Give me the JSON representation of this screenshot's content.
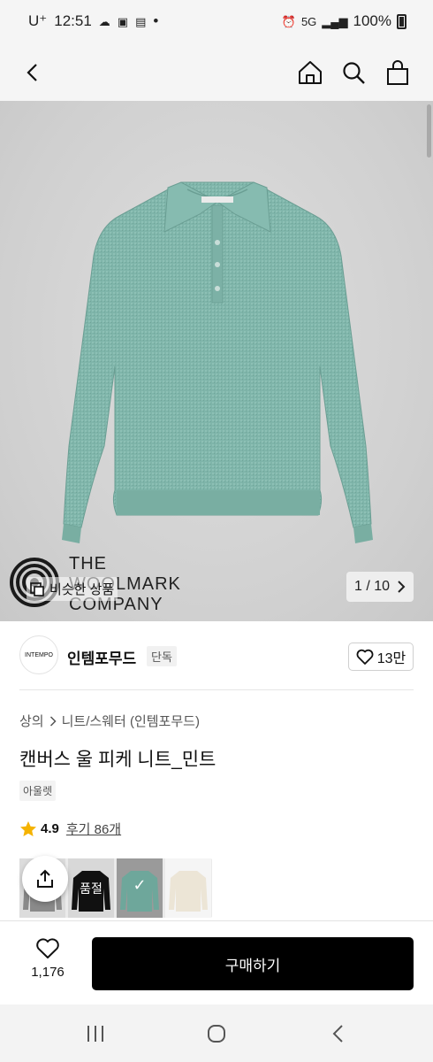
{
  "status_bar": {
    "carrier": "U⁺",
    "time": "12:51",
    "battery": "100%",
    "network": "5G",
    "dot": "•"
  },
  "nav": {
    "icons": [
      "back-icon",
      "home-icon",
      "search-icon",
      "shopping-bag-icon"
    ]
  },
  "hero": {
    "woolmark_lines": [
      "THE",
      "WOOLMARK",
      "COMPANY"
    ],
    "similar_label": "비슷한 상품",
    "page_indicator": "1 / 10",
    "sweater_color": "#7fb5aa"
  },
  "brand": {
    "logo_text": "INTEMPO",
    "name": "인템포무드",
    "badge": "단독",
    "likes": "13만"
  },
  "product": {
    "breadcrumb": [
      "상의",
      "니트/스웨터 (인템포무드)"
    ],
    "title": "캔버스 울 피케 니트_민트",
    "tag": "아울렛",
    "rating": "4.9",
    "reviews": "후기 86개"
  },
  "options": {
    "soldout_label": "품절",
    "check": "✓",
    "colors": [
      "#8a8a8a",
      "#111111",
      "#6ea79b",
      "#efe9dd"
    ]
  },
  "bottom": {
    "wish_count": "1,176",
    "buy_label": "구매하기"
  },
  "colors": {
    "accent_star": "#f5b301",
    "buy_button": "#000000"
  }
}
